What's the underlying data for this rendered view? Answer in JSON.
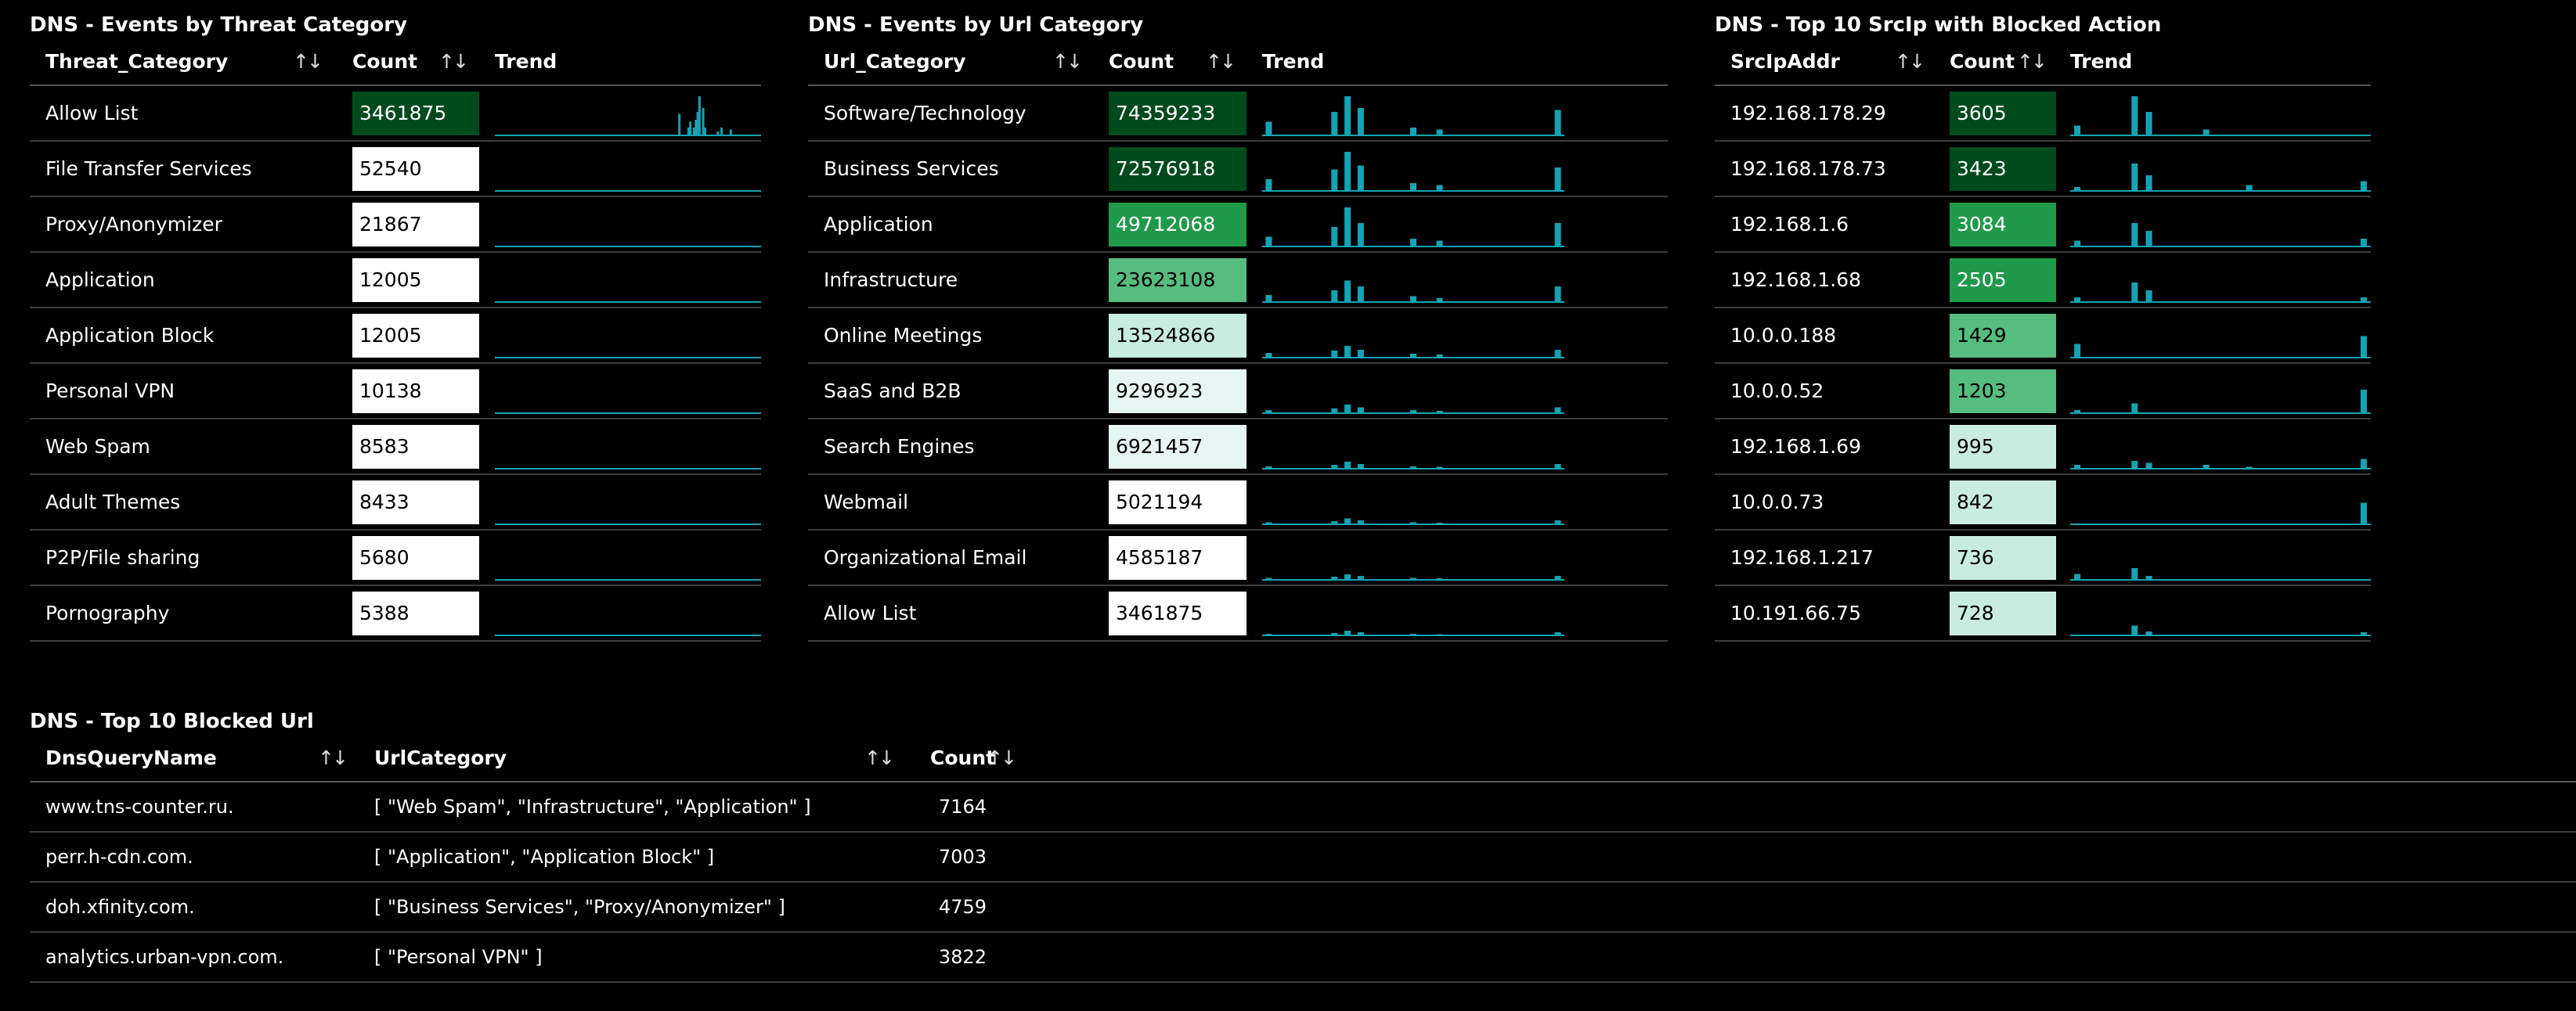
{
  "panels": [
    {
      "title": "DNS - Events by Threat Category",
      "col1": "Threat_Category",
      "col2": "Count",
      "col3": "Trend",
      "max": 3461875,
      "rows": [
        {
          "label": "Allow List",
          "count": "3461875",
          "value": 3461875,
          "trend": [
            0,
            0,
            0,
            0,
            0,
            0,
            0,
            0,
            0,
            0,
            0,
            0,
            0,
            0,
            0,
            0,
            0,
            0,
            0,
            0,
            0,
            0,
            0,
            0,
            0,
            0,
            0,
            0,
            0,
            0,
            0,
            0,
            0,
            0,
            0,
            0,
            0,
            0,
            0,
            0,
            0,
            0,
            0,
            0,
            0,
            0,
            0,
            0,
            0,
            0,
            0,
            0,
            0,
            0,
            0,
            0,
            0,
            0,
            0,
            0,
            0,
            0,
            0,
            0,
            0,
            0,
            0,
            0,
            0,
            0,
            0,
            0,
            0,
            0,
            0,
            0,
            0,
            0,
            0,
            0,
            0,
            0,
            0,
            0,
            0,
            0,
            0,
            0,
            0,
            0,
            0,
            0,
            0,
            0,
            0,
            0,
            0,
            0,
            0,
            0,
            0.55,
            0,
            0,
            0,
            0,
            0.2,
            0.35,
            0,
            0.2,
            0.4,
            0.6,
            1,
            0,
            0.7,
            0.2,
            0,
            0,
            0,
            0,
            0,
            0,
            0.1,
            0,
            0.2,
            0,
            0,
            0,
            0,
            0.15,
            0,
            0,
            0,
            0,
            0,
            0,
            0,
            0,
            0,
            0,
            0,
            0,
            0,
            0,
            0,
            0
          ]
        },
        {
          "label": "File Transfer Services",
          "count": "52540",
          "value": 52540,
          "trend": []
        },
        {
          "label": "Proxy/Anonymizer",
          "count": "21867",
          "value": 21867,
          "trend": []
        },
        {
          "label": "Application",
          "count": "12005",
          "value": 12005,
          "trend": []
        },
        {
          "label": "Application Block",
          "count": "12005",
          "value": 12005,
          "trend": []
        },
        {
          "label": "Personal VPN",
          "count": "10138",
          "value": 10138,
          "trend": []
        },
        {
          "label": "Web Spam",
          "count": "8583",
          "value": 8583,
          "trend": []
        },
        {
          "label": "Adult Themes",
          "count": "8433",
          "value": 8433,
          "trend": []
        },
        {
          "label": "P2P/File sharing",
          "count": "5680",
          "value": 5680,
          "trend": []
        },
        {
          "label": "Pornography",
          "count": "5388",
          "value": 5388,
          "trend": []
        }
      ]
    },
    {
      "title": "DNS - Events by Url Category",
      "col1": "Url_Category",
      "col2": "Count",
      "col3": "Trend",
      "max": 74359233,
      "rows": [
        {
          "label": "Software/Technology",
          "count": "74359233",
          "value": 74359233,
          "trend": [
            0.35,
            0,
            0,
            0,
            0,
            0.6,
            1,
            0.7,
            0,
            0,
            0,
            0.2,
            0,
            0.15,
            0,
            0,
            0,
            0,
            0,
            0,
            0,
            0,
            0.65
          ]
        },
        {
          "label": "Business Services",
          "count": "72576918",
          "value": 72576918,
          "trend": [
            0.3,
            0,
            0,
            0,
            0,
            0.55,
            1,
            0.65,
            0,
            0,
            0,
            0.2,
            0,
            0.15,
            0,
            0,
            0,
            0,
            0,
            0,
            0,
            0,
            0.6
          ]
        },
        {
          "label": "Application",
          "count": "49712068",
          "value": 49712068,
          "trend": [
            0.25,
            0,
            0,
            0,
            0,
            0.5,
            1,
            0.6,
            0,
            0,
            0,
            0.2,
            0,
            0.15,
            0,
            0,
            0,
            0,
            0,
            0,
            0,
            0,
            0.6
          ]
        },
        {
          "label": "Infrastructure",
          "count": "23623108",
          "value": 23623108,
          "trend": [
            0.18,
            0,
            0,
            0,
            0,
            0.3,
            0.55,
            0.4,
            0,
            0,
            0,
            0.15,
            0,
            0.1,
            0,
            0,
            0,
            0,
            0,
            0,
            0,
            0,
            0.4
          ]
        },
        {
          "label": "Online Meetings",
          "count": "13524866",
          "value": 13524866,
          "trend": [
            0.12,
            0,
            0,
            0,
            0,
            0.18,
            0.3,
            0.2,
            0,
            0,
            0,
            0.1,
            0,
            0.08,
            0,
            0,
            0,
            0,
            0,
            0,
            0,
            0,
            0.2
          ]
        },
        {
          "label": "SaaS and B2B",
          "count": "9296923",
          "value": 9296923,
          "trend": [
            0.08,
            0,
            0,
            0,
            0,
            0.12,
            0.22,
            0.15,
            0,
            0,
            0,
            0.08,
            0,
            0.06,
            0,
            0,
            0,
            0,
            0,
            0,
            0,
            0,
            0.15
          ]
        },
        {
          "label": "Search Engines",
          "count": "6921457",
          "value": 6921457,
          "trend": [
            0.06,
            0,
            0,
            0,
            0,
            0.1,
            0.18,
            0.12,
            0,
            0,
            0,
            0.06,
            0,
            0.05,
            0,
            0,
            0,
            0,
            0,
            0,
            0,
            0,
            0.12
          ]
        },
        {
          "label": "Webmail",
          "count": "5021194",
          "value": 5021194,
          "trend": [
            0.05,
            0,
            0,
            0,
            0,
            0.08,
            0.15,
            0.1,
            0,
            0,
            0,
            0.05,
            0,
            0.04,
            0,
            0,
            0,
            0,
            0,
            0,
            0,
            0,
            0.1
          ]
        },
        {
          "label": "Organizational Email",
          "count": "4585187",
          "value": 4585187,
          "trend": [
            0.05,
            0,
            0,
            0,
            0,
            0.08,
            0.14,
            0.1,
            0,
            0,
            0,
            0.05,
            0,
            0.04,
            0,
            0,
            0,
            0,
            0,
            0,
            0,
            0,
            0.1
          ]
        },
        {
          "label": "Allow List",
          "count": "3461875",
          "value": 3461875,
          "trend": [
            0.04,
            0,
            0,
            0,
            0,
            0.06,
            0.12,
            0.08,
            0,
            0,
            0,
            0.04,
            0,
            0.03,
            0,
            0,
            0,
            0,
            0,
            0,
            0,
            0,
            0.08
          ]
        }
      ]
    },
    {
      "title": "DNS - Top 10 SrcIp with Blocked Action",
      "col1": "SrcIpAddr",
      "col2": "Count",
      "col3": "Trend",
      "max": 3605,
      "rows": [
        {
          "label": "192.168.178.29",
          "count": "3605",
          "value": 3605,
          "trend": [
            0.25,
            0,
            0,
            0,
            1,
            0.6,
            0,
            0,
            0,
            0.15,
            0,
            0,
            0,
            0,
            0,
            0,
            0,
            0,
            0,
            0,
            0
          ]
        },
        {
          "label": "192.168.178.73",
          "count": "3423",
          "value": 3423,
          "trend": [
            0.1,
            0,
            0,
            0,
            0.7,
            0.4,
            0,
            0,
            0,
            0,
            0,
            0,
            0.15,
            0,
            0,
            0,
            0,
            0,
            0,
            0,
            0.25
          ]
        },
        {
          "label": "192.168.1.6",
          "count": "3084",
          "value": 3084,
          "trend": [
            0.15,
            0,
            0,
            0,
            0.6,
            0.4,
            0,
            0,
            0,
            0,
            0,
            0,
            0,
            0,
            0,
            0,
            0,
            0,
            0,
            0,
            0.2
          ]
        },
        {
          "label": "192.168.1.68",
          "count": "2505",
          "value": 2505,
          "trend": [
            0.12,
            0,
            0,
            0,
            0.5,
            0.3,
            0,
            0,
            0,
            0,
            0,
            0,
            0,
            0,
            0,
            0,
            0,
            0,
            0,
            0,
            0.12
          ]
        },
        {
          "label": "10.0.0.188",
          "count": "1429",
          "value": 1429,
          "trend": [
            0.35,
            0,
            0,
            0,
            0,
            0,
            0,
            0,
            0,
            0,
            0,
            0,
            0,
            0,
            0,
            0,
            0,
            0,
            0,
            0,
            0.55
          ]
        },
        {
          "label": "10.0.0.52",
          "count": "1203",
          "value": 1203,
          "trend": [
            0.08,
            0,
            0,
            0,
            0.25,
            0,
            0,
            0,
            0,
            0,
            0,
            0,
            0,
            0,
            0,
            0,
            0,
            0,
            0,
            0,
            0.6
          ]
        },
        {
          "label": "192.168.1.69",
          "count": "995",
          "value": 995,
          "trend": [
            0.1,
            0,
            0,
            0,
            0.2,
            0.15,
            0,
            0,
            0,
            0.1,
            0,
            0,
            0.05,
            0,
            0,
            0,
            0,
            0,
            0,
            0,
            0.25
          ]
        },
        {
          "label": "10.0.0.73",
          "count": "842",
          "value": 842,
          "trend": [
            0,
            0,
            0,
            0,
            0,
            0,
            0,
            0,
            0,
            0,
            0,
            0,
            0,
            0,
            0,
            0,
            0,
            0,
            0,
            0,
            0.55
          ]
        },
        {
          "label": "192.168.1.217",
          "count": "736",
          "value": 736,
          "trend": [
            0.15,
            0,
            0,
            0,
            0.3,
            0.1,
            0,
            0,
            0,
            0,
            0,
            0,
            0,
            0,
            0,
            0,
            0,
            0,
            0,
            0,
            0
          ]
        },
        {
          "label": "10.191.66.75",
          "count": "728",
          "value": 728,
          "trend": [
            0,
            0,
            0,
            0,
            0.25,
            0.1,
            0,
            0,
            0,
            0,
            0,
            0,
            0,
            0,
            0,
            0,
            0,
            0,
            0,
            0,
            0.08
          ]
        }
      ]
    }
  ],
  "blocked": {
    "title": "DNS - Top 10 Blocked Url",
    "col1": "DnsQueryName",
    "col2": "UrlCategory",
    "col3": "Count",
    "rows": [
      {
        "name": "www.tns-counter.ru.",
        "category": "[ \"Web Spam\", \"Infrastructure\", \"Application\" ]",
        "count": "7164"
      },
      {
        "name": "perr.h-cdn.com.",
        "category": "[ \"Application\", \"Application Block\" ]",
        "count": "7003"
      },
      {
        "name": "doh.xfinity.com.",
        "category": "[ \"Business Services\", \"Proxy/Anonymizer\" ]",
        "count": "4759"
      },
      {
        "name": "analytics.urban-vpn.com.",
        "category": "[ \"Personal VPN\" ]",
        "count": "3822"
      }
    ]
  },
  "sort_glyph": "↑↓",
  "colors": {
    "accent_bar": "#13a3b5",
    "heat_dark": "#004b1c",
    "heat_mid": "#1e9a4a",
    "heat_light": "#55bd80",
    "heat_pale": "#c9ece0",
    "heat_lowest": "#ffffff"
  }
}
